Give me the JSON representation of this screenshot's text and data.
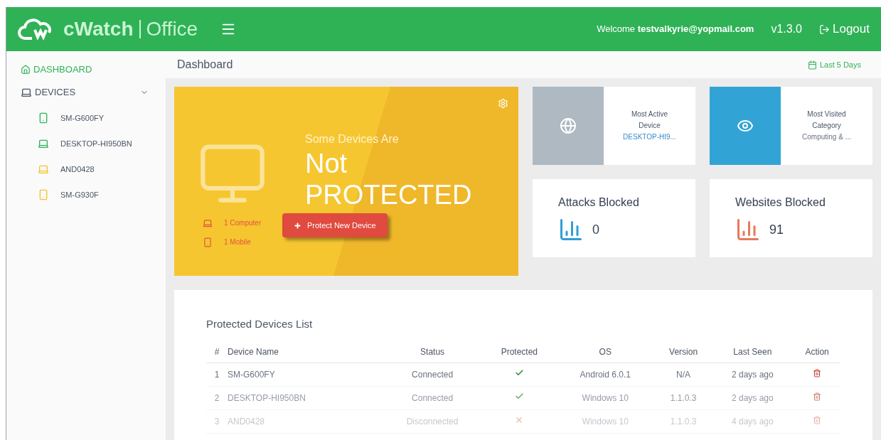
{
  "header": {
    "brand": "cWatch",
    "product": "Office",
    "welcome": "Welcome",
    "user": "testvalkyrie@yopmail.com",
    "version": "v1.3.0",
    "logout": "Logout"
  },
  "sidebar": {
    "items": [
      {
        "label": "DASHBOARD",
        "selected": true
      },
      {
        "label": "DEVICES",
        "selected": false,
        "expanded": true,
        "children": [
          {
            "label": "SM-G600FY",
            "kind": "mobile",
            "color": "#2fb156"
          },
          {
            "label": "DESKTOP-HI950BN",
            "kind": "laptop",
            "color": "#2fb156"
          },
          {
            "label": "AND0428",
            "kind": "laptop",
            "color": "#f5c12e"
          },
          {
            "label": "SM-G930F",
            "kind": "mobile",
            "color": "#f5c12e"
          }
        ]
      }
    ]
  },
  "page_title": "Dashboard",
  "date_range": "Last 5 Days",
  "status_card": {
    "subtitle": "Some Devices Are",
    "title_1": "Not",
    "title_2": "PROTECTED",
    "counts": [
      {
        "kind": "laptop",
        "label": "1 Computer"
      },
      {
        "kind": "mobile",
        "label": "1 Mobile"
      }
    ],
    "button": "Protect New Device"
  },
  "info_cards": [
    {
      "kind": "globe",
      "label": "Most Active Device",
      "value": "DESKTOP-HI9..."
    },
    {
      "kind": "eye",
      "label": "Most Visited Category",
      "value": "Computing & ..."
    }
  ],
  "stat_cards": [
    {
      "title": "Attacks Blocked",
      "value": "0",
      "color": "#2d9fd8"
    },
    {
      "title": "Websites Blocked",
      "value": "91",
      "color": "#e9785a"
    }
  ],
  "table": {
    "title": "Protected Devices List",
    "columns": [
      "#",
      "Device Name",
      "Status",
      "Protected",
      "OS",
      "Version",
      "Last Seen",
      "Action"
    ],
    "rows": [
      {
        "num": "1",
        "name": "SM-G600FY",
        "status": "Connected",
        "protected": true,
        "os": "Android 6.0.1",
        "version": "N/A",
        "last_seen": "2 days ago"
      },
      {
        "num": "2",
        "name": "DESKTOP-HI950BN",
        "status": "Connected",
        "protected": true,
        "os": "Windows 10",
        "version": "1.1.0.3",
        "last_seen": "2 days ago"
      },
      {
        "num": "3",
        "name": "AND0428",
        "status": "Disconnected",
        "protected": false,
        "os": "Windows 10",
        "version": "1.1.0.3",
        "last_seen": "4 days ago"
      }
    ]
  }
}
